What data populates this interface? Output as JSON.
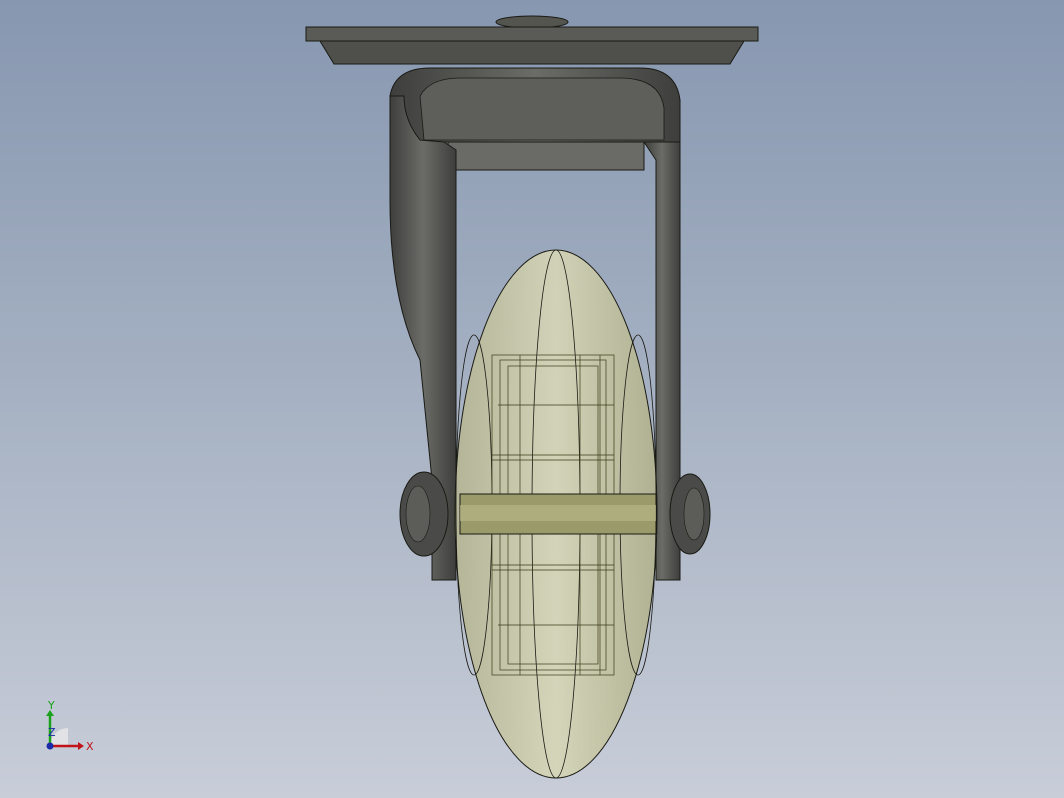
{
  "viewport": {
    "background_top": "#8797b0",
    "background_bottom": "#c8cdd8"
  },
  "model": {
    "metal_color": "#4a4a48",
    "metal_light": "#6e6e6a",
    "wheel_color": "#c9c9a6",
    "edge_color": "#1a1a14"
  },
  "triad": {
    "x_label": "X",
    "y_label": "Y",
    "z_label": "Z",
    "x_color": "#c0141a",
    "y_color": "#1aa01a",
    "z_color": "#1a2aa8"
  }
}
